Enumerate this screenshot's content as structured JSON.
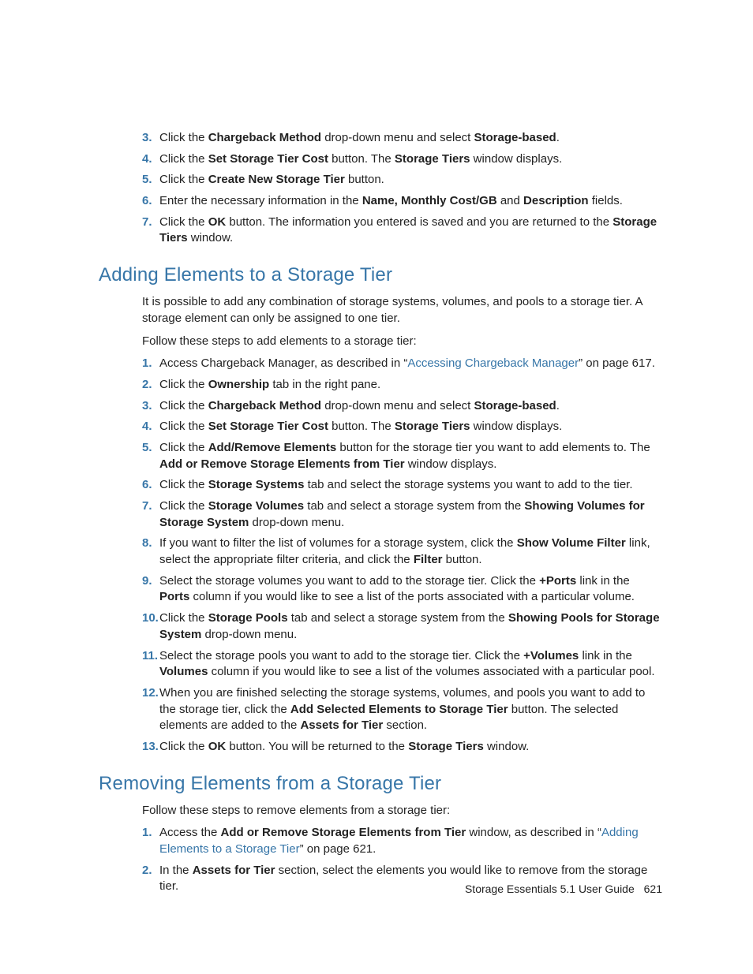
{
  "intro_steps": [
    {
      "n": "3",
      "parts": [
        {
          "t": "Click the "
        },
        {
          "t": "Chargeback Method",
          "b": true
        },
        {
          "t": " drop-down menu and select "
        },
        {
          "t": "Storage-based",
          "b": true
        },
        {
          "t": "."
        }
      ]
    },
    {
      "n": "4",
      "parts": [
        {
          "t": "Click the "
        },
        {
          "t": "Set Storage Tier Cost",
          "b": true
        },
        {
          "t": " button. The "
        },
        {
          "t": "Storage Tiers",
          "b": true
        },
        {
          "t": " window displays."
        }
      ]
    },
    {
      "n": "5",
      "parts": [
        {
          "t": "Click the "
        },
        {
          "t": "Create New Storage Tier",
          "b": true
        },
        {
          "t": " button."
        }
      ]
    },
    {
      "n": "6",
      "parts": [
        {
          "t": "Enter the necessary information in the "
        },
        {
          "t": "Name, Monthly Cost/GB",
          "b": true
        },
        {
          "t": " and "
        },
        {
          "t": "Description",
          "b": true
        },
        {
          "t": " fields."
        }
      ]
    },
    {
      "n": "7",
      "parts": [
        {
          "t": "Click the "
        },
        {
          "t": "OK",
          "b": true
        },
        {
          "t": " button. The information you entered is saved and you are returned to the "
        },
        {
          "t": "Storage Tiers",
          "b": true
        },
        {
          "t": " window."
        }
      ]
    }
  ],
  "section1": {
    "title": "Adding Elements to a Storage Tier",
    "p1": "It is possible to add any combination of storage systems, volumes, and pools to a storage tier. A storage element can only be assigned to one tier.",
    "p2": "Follow these steps to add elements to a storage tier:",
    "steps": [
      {
        "n": "1",
        "parts": [
          {
            "t": "Access Chargeback Manager, as described in “"
          },
          {
            "t": "Accessing Chargeback Manager",
            "link": true
          },
          {
            "t": "” on page 617."
          }
        ]
      },
      {
        "n": "2",
        "parts": [
          {
            "t": "Click the "
          },
          {
            "t": "Ownership",
            "b": true
          },
          {
            "t": " tab in the right pane."
          }
        ]
      },
      {
        "n": "3",
        "parts": [
          {
            "t": "Click the "
          },
          {
            "t": "Chargeback Method",
            "b": true
          },
          {
            "t": " drop-down menu and select "
          },
          {
            "t": "Storage-based",
            "b": true
          },
          {
            "t": "."
          }
        ]
      },
      {
        "n": "4",
        "parts": [
          {
            "t": "Click the "
          },
          {
            "t": "Set Storage Tier Cost",
            "b": true
          },
          {
            "t": " button. The "
          },
          {
            "t": "Storage Tiers",
            "b": true
          },
          {
            "t": " window displays."
          }
        ]
      },
      {
        "n": "5",
        "parts": [
          {
            "t": "Click the "
          },
          {
            "t": "Add/Remove Elements",
            "b": true
          },
          {
            "t": " button for the storage tier you want to add elements to. The "
          },
          {
            "t": "Add or Remove Storage Elements from Tier",
            "b": true
          },
          {
            "t": " window displays."
          }
        ]
      },
      {
        "n": "6",
        "parts": [
          {
            "t": "Click the "
          },
          {
            "t": "Storage Systems",
            "b": true
          },
          {
            "t": " tab and select the storage systems you want to add to the tier."
          }
        ]
      },
      {
        "n": "7",
        "parts": [
          {
            "t": "Click the "
          },
          {
            "t": "Storage Volumes",
            "b": true
          },
          {
            "t": " tab and select a storage system from the "
          },
          {
            "t": "Showing Volumes for Storage System",
            "b": true
          },
          {
            "t": " drop-down menu."
          }
        ]
      },
      {
        "n": "8",
        "parts": [
          {
            "t": "If you want to filter the list of volumes for a storage system, click the "
          },
          {
            "t": "Show Volume Filter",
            "b": true
          },
          {
            "t": " link, select the appropriate filter criteria, and click the "
          },
          {
            "t": "Filter",
            "b": true
          },
          {
            "t": " button."
          }
        ]
      },
      {
        "n": "9",
        "parts": [
          {
            "t": "Select the storage volumes you want to add to the storage tier. Click the "
          },
          {
            "t": "+Ports",
            "b": true
          },
          {
            "t": " link in the "
          },
          {
            "t": "Ports",
            "b": true
          },
          {
            "t": " column if you would like to see a list of the ports associated with a particular volume."
          }
        ]
      },
      {
        "n": "10",
        "parts": [
          {
            "t": "Click the "
          },
          {
            "t": "Storage Pools",
            "b": true
          },
          {
            "t": " tab and select a storage system from the "
          },
          {
            "t": "Showing Pools for Storage System",
            "b": true
          },
          {
            "t": " drop-down menu."
          }
        ]
      },
      {
        "n": "11",
        "parts": [
          {
            "t": "Select the storage pools you want to add to the storage tier. Click the "
          },
          {
            "t": "+Volumes",
            "b": true
          },
          {
            "t": " link in the "
          },
          {
            "t": "Volumes",
            "b": true
          },
          {
            "t": " column if you would like to see a list of the volumes associated with a particular pool."
          }
        ]
      },
      {
        "n": "12",
        "parts": [
          {
            "t": "When you are finished selecting the storage systems, volumes, and pools you want to add to the storage tier, click the "
          },
          {
            "t": "Add Selected Elements to Storage Tier",
            "b": true
          },
          {
            "t": " button. The selected elements are added to the "
          },
          {
            "t": "Assets for Tier",
            "b": true
          },
          {
            "t": " section."
          }
        ]
      },
      {
        "n": "13",
        "parts": [
          {
            "t": "Click the "
          },
          {
            "t": "OK",
            "b": true
          },
          {
            "t": " button. You will be returned to the "
          },
          {
            "t": "Storage Tiers",
            "b": true
          },
          {
            "t": " window."
          }
        ]
      }
    ]
  },
  "section2": {
    "title": "Removing Elements from a Storage Tier",
    "p1": "Follow these steps to remove elements from a storage tier:",
    "steps": [
      {
        "n": "1",
        "parts": [
          {
            "t": "Access the "
          },
          {
            "t": "Add or Remove Storage Elements from Tier",
            "b": true
          },
          {
            "t": " window, as described in “"
          },
          {
            "t": "Adding Elements to a Storage Tier",
            "link": true
          },
          {
            "t": "” on page 621."
          }
        ]
      },
      {
        "n": "2",
        "parts": [
          {
            "t": "In the "
          },
          {
            "t": "Assets for Tier",
            "b": true
          },
          {
            "t": " section, select the elements you would like to remove from the storage tier."
          }
        ]
      }
    ]
  },
  "footer": {
    "text": "Storage Essentials 5.1 User Guide",
    "page": "621"
  }
}
